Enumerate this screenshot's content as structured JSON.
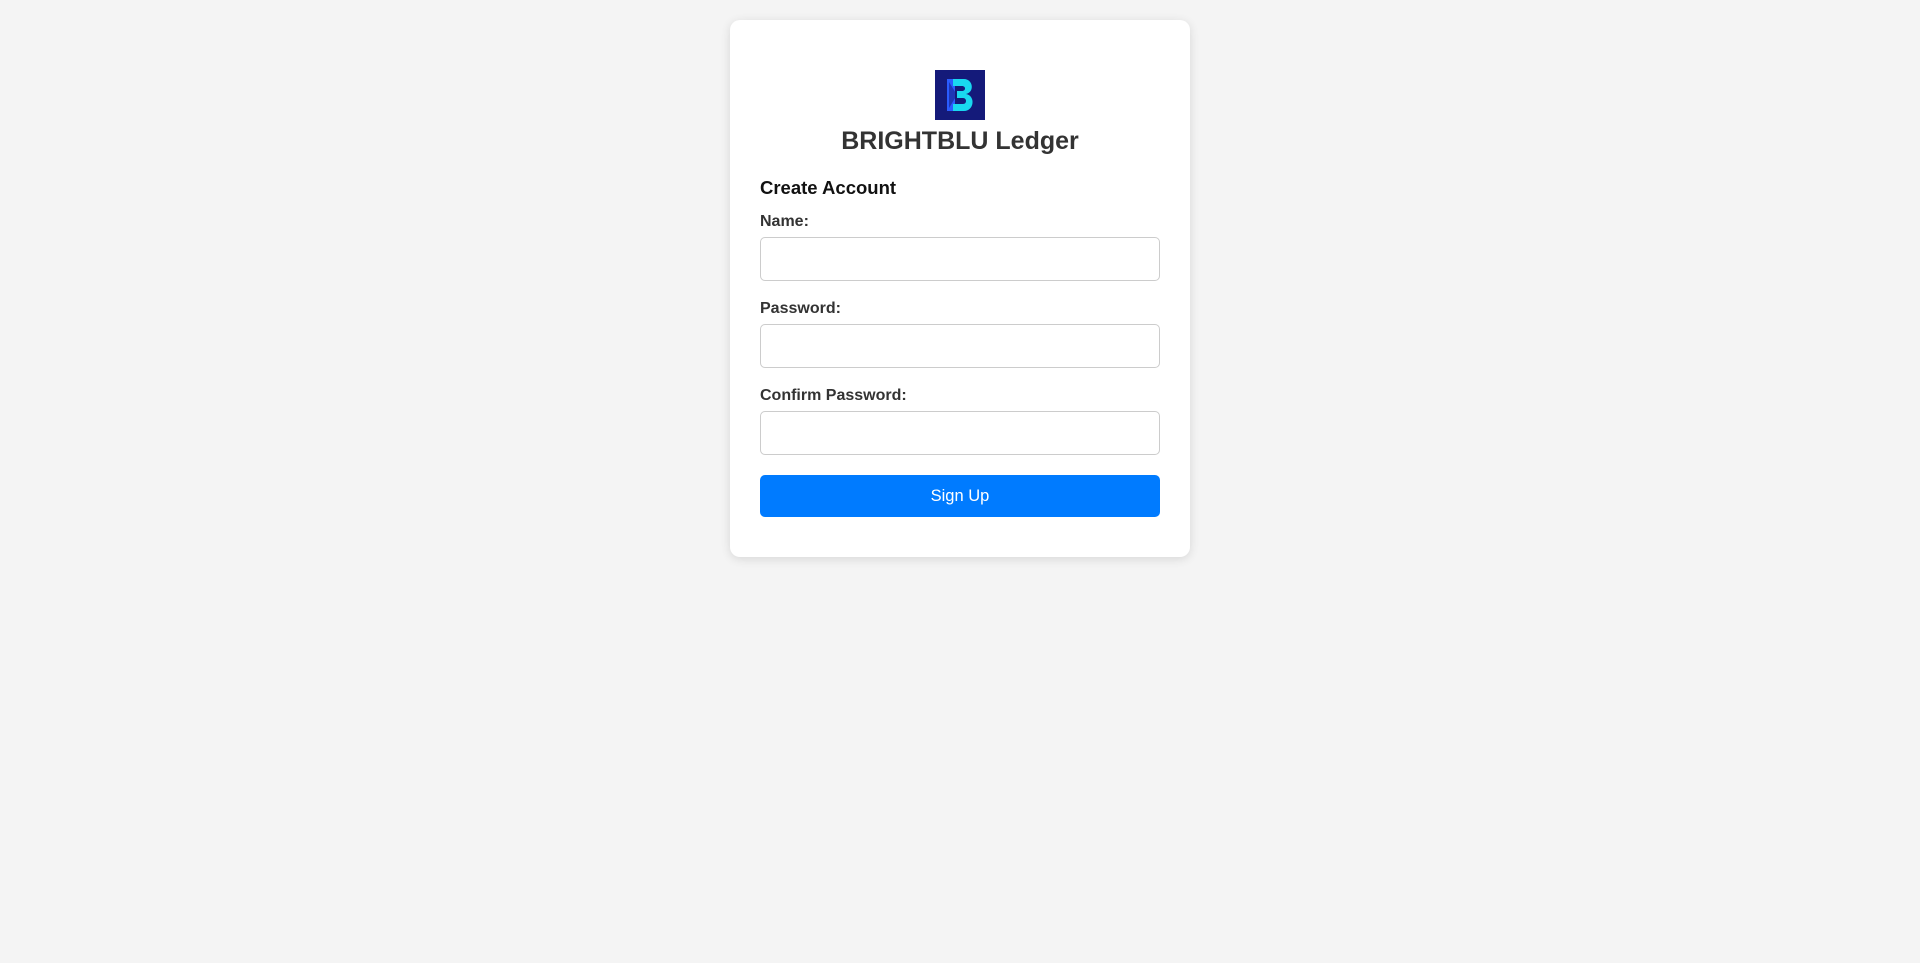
{
  "brand": {
    "name": "BRIGHTBLU Ledger",
    "logo_icon": "brightblu-b-logo-icon",
    "logo_colors": {
      "background": "#141a7a",
      "accent": "#19d8f0",
      "secondary": "#2a5cff"
    }
  },
  "form": {
    "title": "Create Account",
    "fields": [
      {
        "label": "Name:",
        "value": "",
        "placeholder": ""
      },
      {
        "label": "Password:",
        "value": "",
        "placeholder": ""
      },
      {
        "label": "Confirm Password:",
        "value": "",
        "placeholder": ""
      }
    ],
    "submit_label": "Sign Up"
  },
  "colors": {
    "page_background": "#f4f4f4",
    "card_background": "#ffffff",
    "primary_button": "#007bff",
    "heading_text": "#333333"
  }
}
